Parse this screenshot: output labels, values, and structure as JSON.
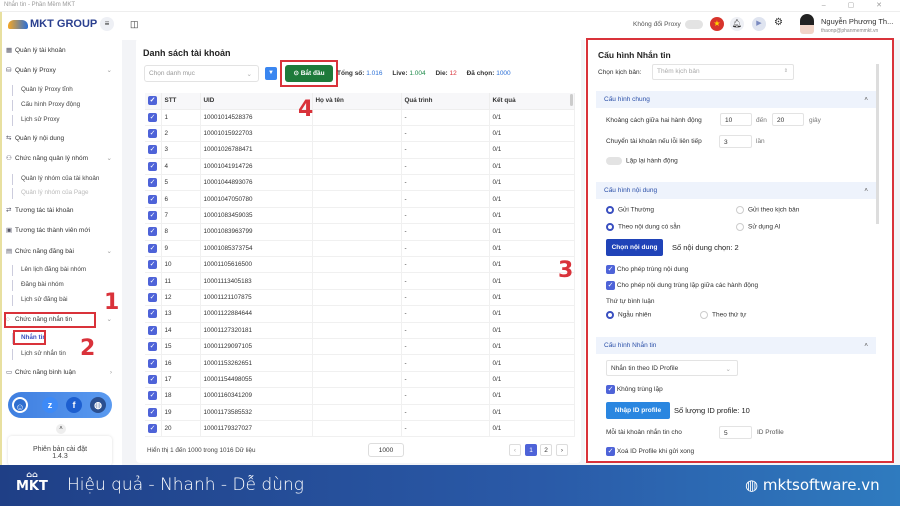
{
  "window": {
    "title": "Nhắn tin - Phần Mềm MKT",
    "controls": "–  ▢  ✕"
  },
  "brand": {
    "logo": "MKT GROUP"
  },
  "sidebar": {
    "items": [
      {
        "label": "Quản lý tài khoản",
        "icon": "grid-icon"
      },
      {
        "label": "Quản lý Proxy",
        "icon": "proxy-icon",
        "sub": [
          "Quản lý Proxy tĩnh",
          "Cấu hình Proxy động",
          "Lịch sử Proxy"
        ]
      },
      {
        "label": "Quản lý nội dung",
        "icon": "content-icon"
      },
      {
        "label": "Chức năng quản lý nhóm",
        "icon": "group-icon",
        "sub": [
          "Quản lý nhóm của tài khoản",
          "Quản lý nhóm của Page"
        ]
      },
      {
        "label": "Tương tác tài khoản",
        "icon": "interact-icon"
      },
      {
        "label": "Tương tác thành viên mới",
        "icon": "member-icon"
      },
      {
        "label": "Chức năng đăng bài",
        "icon": "post-icon",
        "sub": [
          "Lên lịch đăng bài nhóm",
          "Đăng bài nhóm",
          "Lịch sử đăng bài"
        ]
      },
      {
        "label": "Chức năng nhắn tin",
        "icon": "chat-icon",
        "sub": [
          "Nhắn tin",
          "Lịch sử nhắn tin"
        ]
      },
      {
        "label": "Chức năng bình luận",
        "icon": "comment-icon"
      }
    ],
    "version_label": "Phiên bản cài đặt",
    "version": "1.4.3"
  },
  "topbar": {
    "proxy_label": "Không đổi Proxy",
    "user_name": "Nguyễn Phương Th...",
    "user_email": "thaonp@phanmemmkt.vn"
  },
  "main": {
    "title": "Danh sách tài khoản",
    "category_placeholder": "Chọn danh mục",
    "start_label": "Bắt đầu",
    "stats": {
      "total_label": "Tổng số:",
      "total": "1.016",
      "live_label": "Live:",
      "live": "1.004",
      "die_label": "Die:",
      "die": "12",
      "selected_label": "Đã chọn:",
      "selected": "1000"
    },
    "columns": [
      "STT",
      "UID",
      "Họ và tên",
      "Quá trình",
      "Kết quả"
    ],
    "rows": [
      [
        "1",
        "10001014528376",
        "",
        "-",
        "0/1"
      ],
      [
        "2",
        "10001015922703",
        "",
        "-",
        "0/1"
      ],
      [
        "3",
        "10001026788471",
        "",
        "-",
        "0/1"
      ],
      [
        "4",
        "10001041914726",
        "",
        "-",
        "0/1"
      ],
      [
        "5",
        "10001044893076",
        "",
        "-",
        "0/1"
      ],
      [
        "6",
        "10001047050780",
        "",
        "-",
        "0/1"
      ],
      [
        "7",
        "10001083459035",
        "",
        "-",
        "0/1"
      ],
      [
        "8",
        "10001083963799",
        "",
        "-",
        "0/1"
      ],
      [
        "9",
        "10001085373754",
        "",
        "-",
        "0/1"
      ],
      [
        "10",
        "10001105616500",
        "",
        "-",
        "0/1"
      ],
      [
        "11",
        "10001113405183",
        "",
        "-",
        "0/1"
      ],
      [
        "12",
        "10001121107875",
        "",
        "-",
        "0/1"
      ],
      [
        "13",
        "10001122884644",
        "",
        "-",
        "0/1"
      ],
      [
        "14",
        "10001127320181",
        "",
        "-",
        "0/1"
      ],
      [
        "15",
        "10001129097105",
        "",
        "-",
        "0/1"
      ],
      [
        "16",
        "10001153262651",
        "",
        "-",
        "0/1"
      ],
      [
        "17",
        "10001154498055",
        "",
        "-",
        "0/1"
      ],
      [
        "18",
        "10001160341209",
        "",
        "-",
        "0/1"
      ],
      [
        "19",
        "10001173585532",
        "",
        "-",
        "0/1"
      ],
      [
        "20",
        "10001179327027",
        "",
        "-",
        "0/1"
      ]
    ],
    "footer": "Hiển thị 1 đến 1000 trong 1016 Dữ liệu",
    "page_size": "1000",
    "pages": [
      "1",
      "2"
    ],
    "current_page": "1"
  },
  "config": {
    "title": "Cấu hình Nhắn tin",
    "script_label": "Chọn kịch bản:",
    "script_placeholder": "Thêm kịch bản",
    "general": {
      "title": "Cấu hình chung",
      "delay_label": "Khoảng cách giữa hai hành động",
      "delay_from": "10",
      "to_label": "đến",
      "delay_to": "20",
      "unit_sec": "giây",
      "switch_label": "Chuyển tài khoản nếu lỗi liên tiếp",
      "switch_value": "3",
      "unit_times": "lần",
      "repeat_label": "Lặp lại hành động"
    },
    "content": {
      "title": "Cấu hình nội dung",
      "opt_normal": "Gửi Thường",
      "opt_script": "Gửi theo kịch bản",
      "opt_available": "Theo nội dung có sẵn",
      "opt_ai": "Sử dụng AI",
      "choose_btn": "Chọn nội dung",
      "chosen_count": "Số nội dung chọn: 2",
      "allow_dup": "Cho phép trùng nội dung",
      "allow_dup_actions": "Cho phép nội dung trùng lặp giữa các hành động",
      "order_label": "Thứ tự bình luận",
      "order_random": "Ngẫu nhiên",
      "order_seq": "Theo thứ tự"
    },
    "message": {
      "title": "Cấu hình Nhắn tin",
      "mode": "Nhắn tin theo ID Profile",
      "no_dup": "Không trùng lặp",
      "import_btn": "Nhập ID profile",
      "id_count": "Số lượng ID profile: 10",
      "per_account_label": "Mỗi tài khoản nhắn tin cho",
      "per_account": "5",
      "per_unit": "ID Profile",
      "delete_after": "Xoá ID Profile khi gửi xong"
    }
  },
  "annotations": [
    "1",
    "2",
    "3",
    "4"
  ],
  "banner": {
    "logo": "MKT",
    "slogan": "Hiệu quả - Nhanh - Dễ dùng",
    "website": "mktsoftware.vn"
  },
  "colors": {
    "start": "#1e7a3a",
    "accent": "#4e63d8",
    "highlight": "#d9323a",
    "banner": "#1f3f86"
  }
}
